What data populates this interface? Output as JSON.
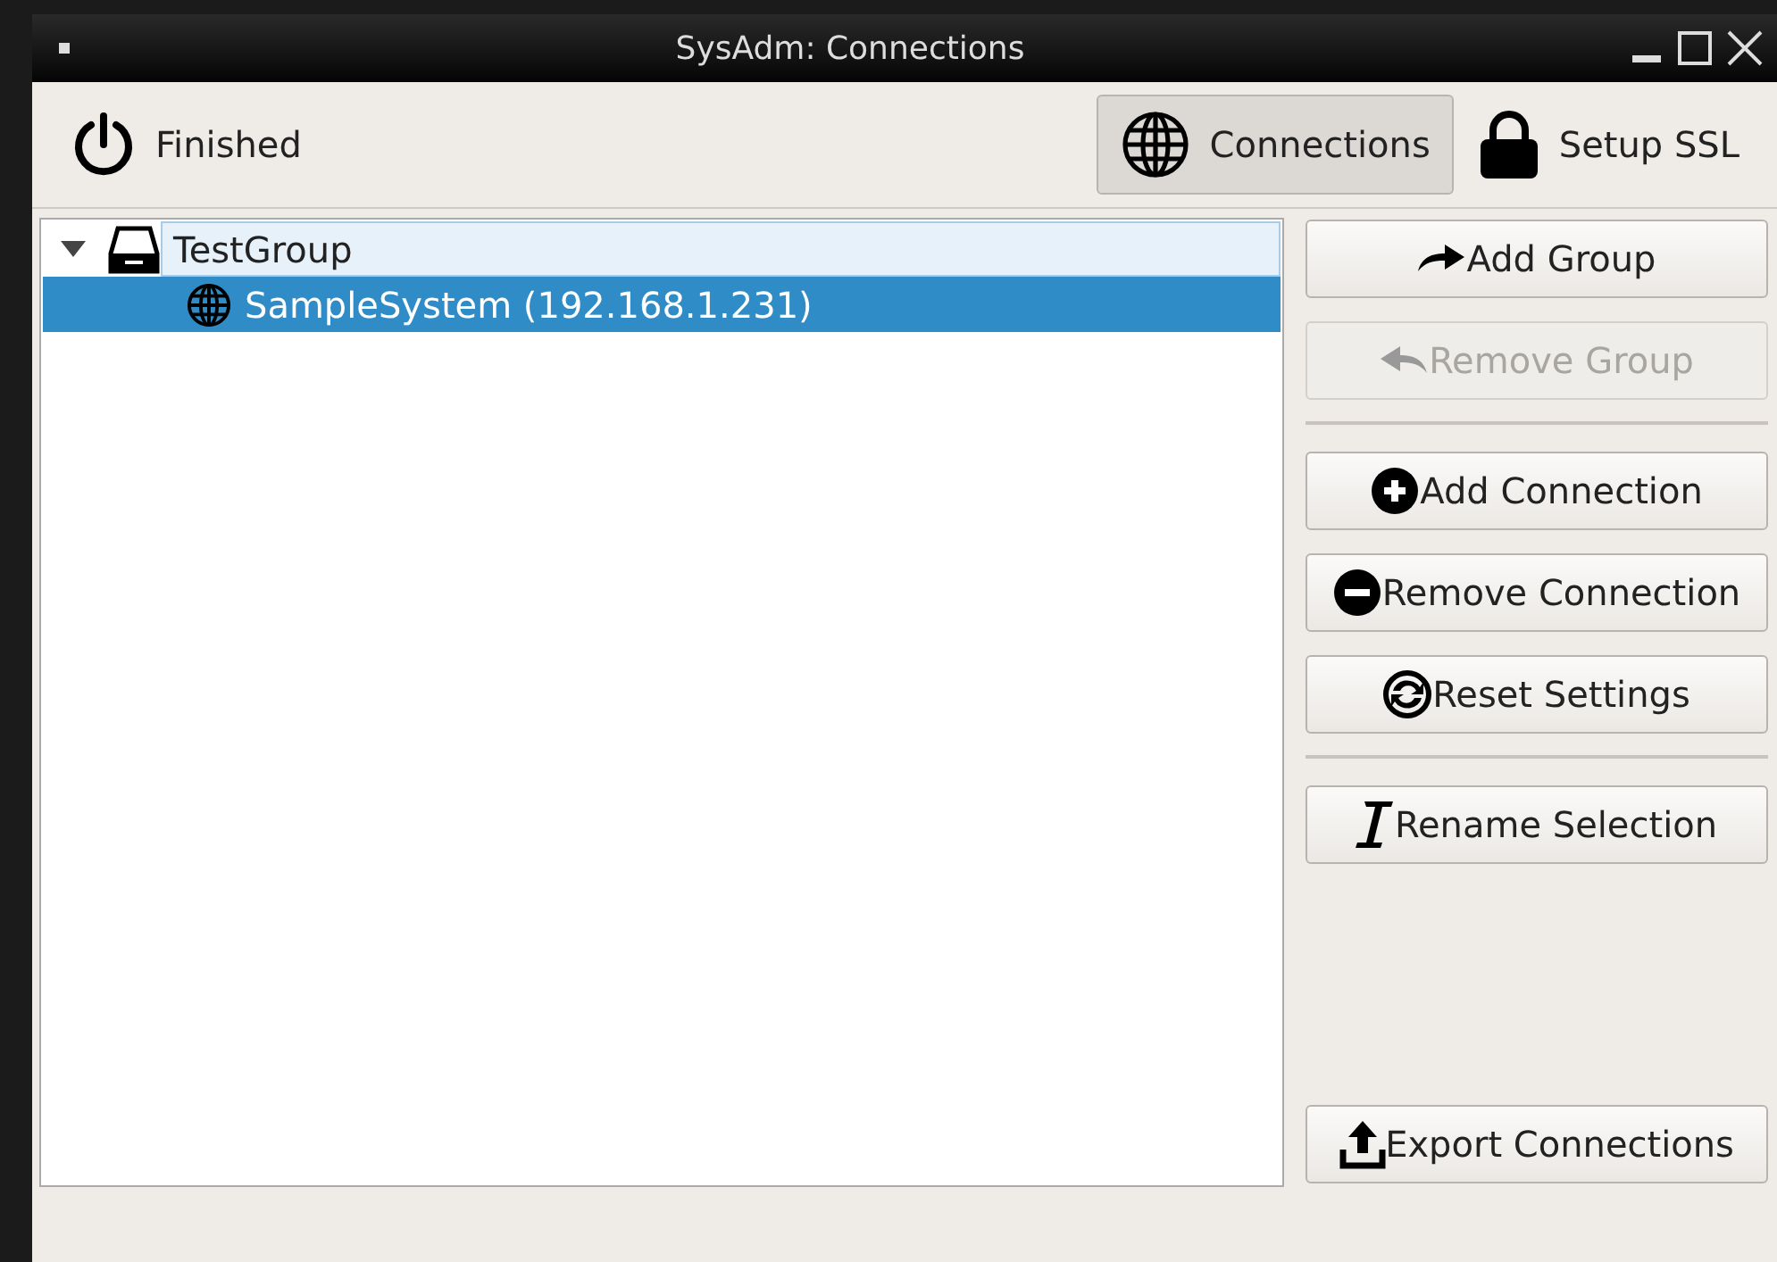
{
  "window": {
    "title": "SysAdm: Connections"
  },
  "toolbar": {
    "left": [
      {
        "label": "Finished",
        "kind": "power",
        "selected": false
      }
    ],
    "right": [
      {
        "label": "Connections",
        "kind": "globe",
        "selected": true
      },
      {
        "label": "Setup SSL",
        "kind": "lock",
        "selected": false
      }
    ]
  },
  "tree": [
    {
      "label": "TestGroup",
      "kind": "group",
      "expanded": true,
      "selected": false,
      "focused": true,
      "children": [
        {
          "label": "SampleSystem (192.168.1.231)",
          "kind": "system",
          "selected": true,
          "focused": false
        }
      ]
    }
  ],
  "button_groups": [
    [
      {
        "label": "Add Group",
        "kind": "add-group",
        "disabled": false
      },
      {
        "label": "Remove Group",
        "kind": "remove-group",
        "disabled": true
      }
    ],
    [
      {
        "label": "Add Connection",
        "kind": "add",
        "disabled": false
      },
      {
        "label": "Remove Connection",
        "kind": "remove",
        "disabled": false
      },
      {
        "label": "Reset Settings",
        "kind": "reset",
        "disabled": false
      }
    ],
    [
      {
        "label": "Rename Selection",
        "kind": "rename",
        "disabled": false
      }
    ]
  ],
  "bottom_button": {
    "label": "Export Connections",
    "kind": "export",
    "disabled": false
  }
}
